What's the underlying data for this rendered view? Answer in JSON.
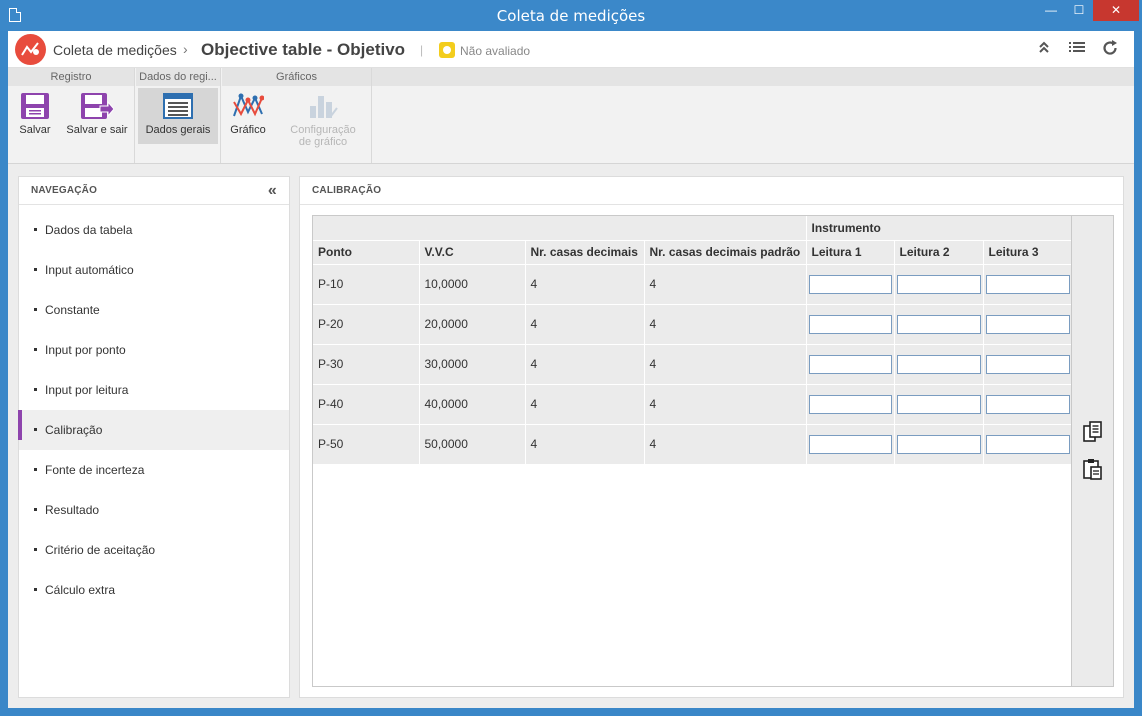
{
  "window": {
    "title": "Coleta de medições",
    "min": "—",
    "max": "☐",
    "close": "✕"
  },
  "header": {
    "app": "Coleta de medições",
    "separator": "›",
    "title": "Objective table - Objetivo",
    "status": "Não avaliado",
    "pipe": "|"
  },
  "ribbon": {
    "groups": [
      {
        "label": "Registro"
      },
      {
        "label": "Dados do regi..."
      },
      {
        "label": "Gráficos"
      }
    ],
    "buttons": {
      "save": "Salvar",
      "save_exit": "Salvar e sair",
      "general_data": "Dados gerais",
      "chart": "Gráfico",
      "chart_config": "Configuração de gráfico"
    }
  },
  "nav": {
    "title": "NAVEGAÇÃO",
    "collapse": "«",
    "items": [
      "Dados da tabela",
      "Input automático",
      "Constante",
      "Input por ponto",
      "Input por leitura",
      "Calibração",
      "Fonte de incerteza",
      "Resultado",
      "Critério de aceitação",
      "Cálculo extra"
    ],
    "active_index": 5
  },
  "main": {
    "title": "CALIBRAÇÃO",
    "group_header": "Instrumento",
    "columns": [
      "Ponto",
      "V.V.C",
      "Nr. casas decimais",
      "Nr. casas decimais padrão",
      "Leitura 1",
      "Leitura 2",
      "Leitura 3"
    ],
    "rows": [
      {
        "ponto": "P-10",
        "vvc": "10,0000",
        "casas": "4",
        "casas_padrao": "4",
        "leituras": [
          "",
          "",
          ""
        ]
      },
      {
        "ponto": "P-20",
        "vvc": "20,0000",
        "casas": "4",
        "casas_padrao": "4",
        "leituras": [
          "",
          "",
          ""
        ]
      },
      {
        "ponto": "P-30",
        "vvc": "30,0000",
        "casas": "4",
        "casas_padrao": "4",
        "leituras": [
          "",
          "",
          ""
        ]
      },
      {
        "ponto": "P-40",
        "vvc": "40,0000",
        "casas": "4",
        "casas_padrao": "4",
        "leituras": [
          "",
          "",
          ""
        ]
      },
      {
        "ponto": "P-50",
        "vvc": "50,0000",
        "casas": "4",
        "casas_padrao": "4",
        "leituras": [
          "",
          "",
          ""
        ]
      }
    ]
  },
  "colors": {
    "accent": "#8e44ad",
    "titlebar": "#3b88c9",
    "logo": "#e84c3d",
    "status": "#f3cd1d",
    "close": "#c7372f"
  },
  "icons": [
    "app-logo-icon",
    "expand-collapse-icon",
    "list-icon",
    "refresh-icon",
    "save-icon",
    "save-exit-icon",
    "general-data-icon",
    "chart-icon",
    "chart-config-icon",
    "copy-icon",
    "paste-icon"
  ]
}
